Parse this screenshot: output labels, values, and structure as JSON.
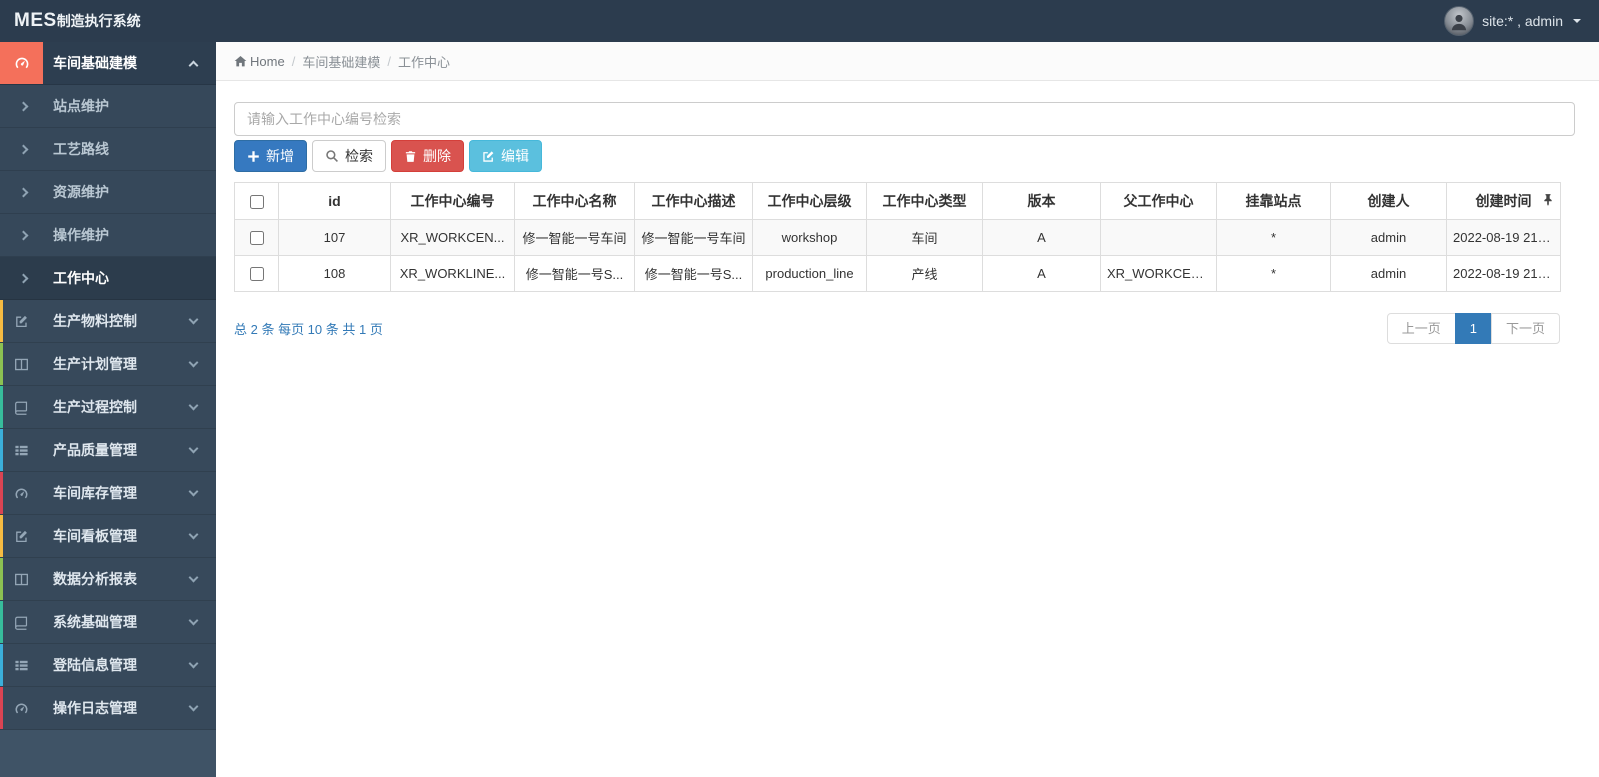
{
  "navbar": {
    "logo_bold": "MES",
    "logo_rest": "制造执行系统",
    "user_label": "site:* , admin"
  },
  "breadcrumb": {
    "home": "Home",
    "sep": "/",
    "items": [
      "车间基础建模",
      "工作中心"
    ]
  },
  "sidebar": {
    "group": {
      "label": "车间基础建模",
      "icon": "gauge-icon",
      "accent": "#f4705b"
    },
    "subitems": [
      {
        "label": "站点维护"
      },
      {
        "label": "工艺路线"
      },
      {
        "label": "资源维护"
      },
      {
        "label": "操作维护"
      },
      {
        "label": "工作中心",
        "active": true
      }
    ],
    "items": [
      {
        "label": "生产物料控制",
        "icon": "pencil-icon",
        "strip": "#f6bb42"
      },
      {
        "label": "生产计划管理",
        "icon": "columns-icon",
        "strip": "#8cc152"
      },
      {
        "label": "生产过程控制",
        "icon": "book-icon",
        "strip": "#37bc9b"
      },
      {
        "label": "产品质量管理",
        "icon": "list-icon",
        "strip": "#3bafda"
      },
      {
        "label": "车间库存管理",
        "icon": "gauge-icon",
        "strip": "#da4453"
      },
      {
        "label": "车间看板管理",
        "icon": "pencil-icon",
        "strip": "#f6bb42"
      },
      {
        "label": "数据分析报表",
        "icon": "columns-icon",
        "strip": "#8cc152"
      },
      {
        "label": "系统基础管理",
        "icon": "book-icon",
        "strip": "#37bc9b"
      },
      {
        "label": "登陆信息管理",
        "icon": "list-icon",
        "strip": "#3bafda"
      },
      {
        "label": "操作日志管理",
        "icon": "gauge-icon",
        "strip": "#da4453"
      }
    ]
  },
  "search": {
    "placeholder": "请输入工作中心编号检索",
    "value": ""
  },
  "toolbar": {
    "add": "新增",
    "search": "检索",
    "delete": "删除",
    "edit": "编辑"
  },
  "table": {
    "columns": [
      "id",
      "工作中心编号",
      "工作中心名称",
      "工作中心描述",
      "工作中心层级",
      "工作中心类型",
      "版本",
      "父工作中心",
      "挂靠站点",
      "创建人",
      "创建时间"
    ],
    "rows": [
      {
        "id": "107",
        "code": "XR_WORKCEN...",
        "name": "修一智能一号车间",
        "desc": "修一智能一号车间",
        "level": "workshop",
        "type": "车间",
        "version": "A",
        "parent": "",
        "station": "*",
        "creator": "admin",
        "created": "2022-08-19 21:1..."
      },
      {
        "id": "108",
        "code": "XR_WORKLINE...",
        "name": "修一智能一号S...",
        "desc": "修一智能一号S...",
        "level": "production_line",
        "type": "产线",
        "version": "A",
        "parent": "XR_WORKCEN...",
        "station": "*",
        "creator": "admin",
        "created": "2022-08-19 21:1..."
      }
    ]
  },
  "pagination": {
    "summary": "总 2 条 每页 10 条 共 1 页",
    "prev": "上一页",
    "current": "1",
    "next": "下一页"
  },
  "colors": {
    "navbar_bg": "#2c3c4e",
    "sidebar_bg": "#37495b",
    "sidebar_active_bg": "#2c3c4c",
    "sidebar_accent_red": "#f4705b",
    "primary": "#337ab7",
    "danger": "#d9534f",
    "info": "#5bc0de",
    "pagination_active": "#337ab7"
  }
}
